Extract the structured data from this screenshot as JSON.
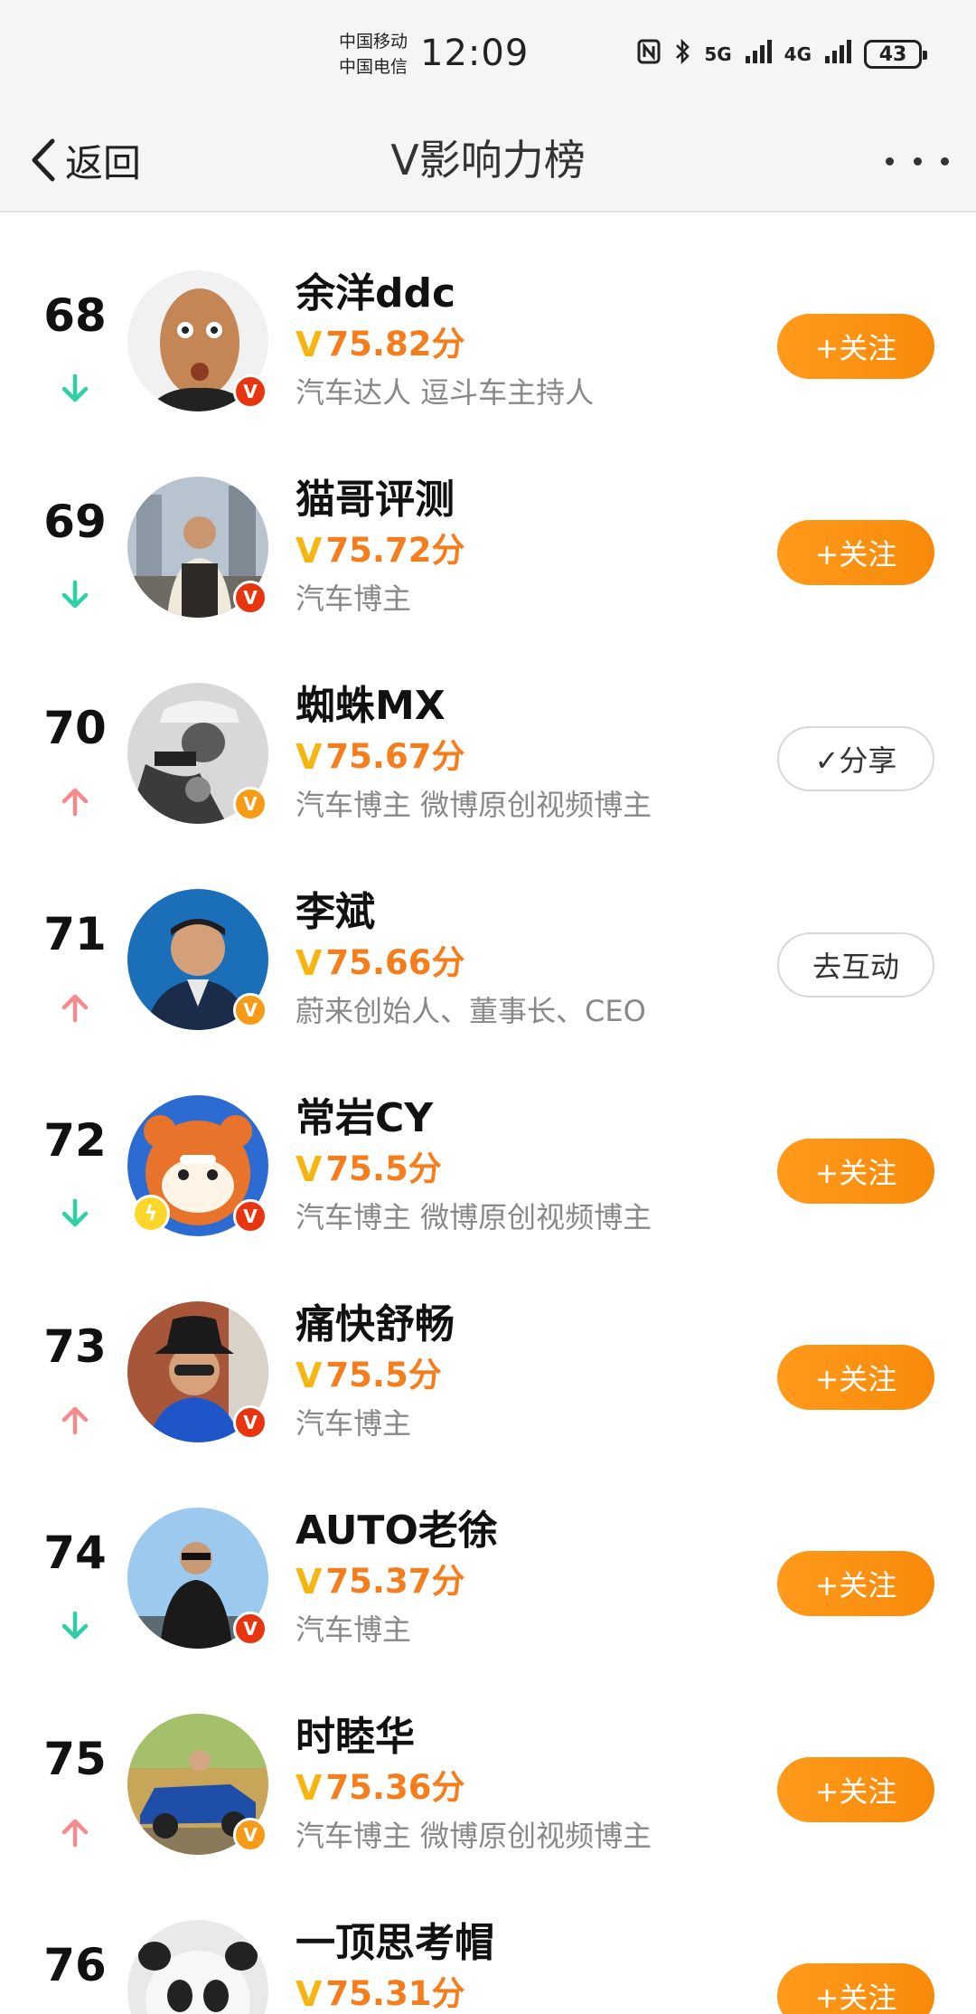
{
  "status_bar": {
    "carrier_1": "中国移动",
    "carrier_2": "中国电信",
    "time": "12:09",
    "signal_1": "5G",
    "signal_2": "4G",
    "battery": "43"
  },
  "nav": {
    "back_label": "返回",
    "title": "V影响力榜"
  },
  "list": [
    {
      "rank": "68",
      "trend": "down",
      "name": "余洋ddc",
      "score": "75.82分",
      "desc": "汽车达人 逗斗车主持人",
      "action": "+关注",
      "action_type": "follow",
      "badge": "red"
    },
    {
      "rank": "69",
      "trend": "down",
      "name": "猫哥评测",
      "score": "75.72分",
      "desc": "汽车博主",
      "action": "+关注",
      "action_type": "follow",
      "badge": "red"
    },
    {
      "rank": "70",
      "trend": "up",
      "name": "蜘蛛MX",
      "score": "75.67分",
      "desc": "汽车博主 微博原创视频博主",
      "action": "✓分享",
      "action_type": "outline",
      "badge": "orange"
    },
    {
      "rank": "71",
      "trend": "up",
      "name": "李斌",
      "score": "75.66分",
      "desc": "蔚来创始人、董事长、CEO",
      "action": "去互动",
      "action_type": "outline",
      "badge": "orange"
    },
    {
      "rank": "72",
      "trend": "down",
      "name": "常岩CY",
      "score": "75.5分",
      "desc": "汽车博主 微博原创视频博主",
      "action": "+关注",
      "action_type": "follow",
      "badge": "red"
    },
    {
      "rank": "73",
      "trend": "up",
      "name": "痛快舒畅",
      "score": "75.5分",
      "desc": "汽车博主",
      "action": "+关注",
      "action_type": "follow",
      "badge": "red"
    },
    {
      "rank": "74",
      "trend": "down",
      "name": "AUTO老徐",
      "score": "75.37分",
      "desc": "汽车博主",
      "action": "+关注",
      "action_type": "follow",
      "badge": "red"
    },
    {
      "rank": "75",
      "trend": "up",
      "name": "时睦华",
      "score": "75.36分",
      "desc": "汽车博主 微博原创视频博主",
      "action": "+关注",
      "action_type": "follow",
      "badge": "orange"
    },
    {
      "rank": "76",
      "trend": "none",
      "name": "一顶思考帽",
      "score": "75.31分",
      "desc": "",
      "action": "+关注",
      "action_type": "follow",
      "badge": "none"
    }
  ],
  "colors": {
    "score": "#f57d1c",
    "v_mark": "#f7b512",
    "follow_button": "#fe9a1c",
    "trend_up": "#f58a8a",
    "trend_down": "#2ecfa5"
  }
}
